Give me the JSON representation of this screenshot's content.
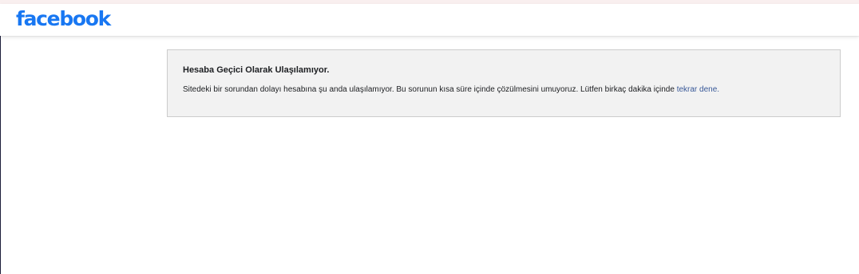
{
  "header": {
    "logo_text": "facebook"
  },
  "error": {
    "title": "Hesaba Geçici Olarak Ulaşılamıyor.",
    "message": "Sitedeki bir sorundan dolayı hesabına şu anda ulaşılamıyor. Bu sorunun kısa süre içinde çözülmesini umuyoruz. Lütfen birkaç dakika içinde ",
    "retry_link": "tekrar dene."
  },
  "colors": {
    "brand": "#1877f2",
    "link": "#385898",
    "box_background": "#f2f2f2",
    "box_border": "#cccccc"
  }
}
